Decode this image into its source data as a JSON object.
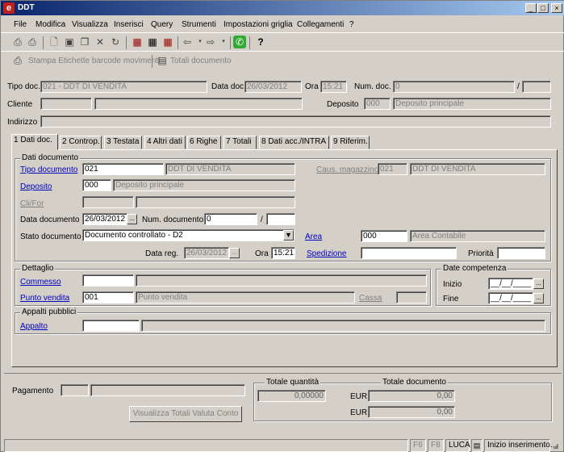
{
  "window": {
    "title": "DDT",
    "icon_letter": "e",
    "min": "_",
    "max": "□",
    "close": "×"
  },
  "menu": [
    "File",
    "Modifica",
    "Visualizza",
    "Inserisci",
    "Query",
    "Strumenti",
    "Impostazioni griglia",
    "Collegamenti",
    "?"
  ],
  "toolbar2": {
    "print_labels": "Stampa Etichette barcode movimenti",
    "totals": "Totali documento"
  },
  "header": {
    "tipo_doc_label": "Tipo doc.",
    "tipo_doc_value": "021 - DDT DI VENDITA",
    "data_doc_label": "Data doc.",
    "data_doc_value": "26/03/2012",
    "ora_label": "Ora",
    "ora_value": "15:21",
    "num_doc_label": "Num. doc.",
    "num_doc_value": "0",
    "slash": "/",
    "cliente_label": "Cliente",
    "deposito_label": "Deposito",
    "deposito_code": "000",
    "deposito_desc": "Deposito principale",
    "indirizzo_label": "Indirizzo"
  },
  "tabs": [
    "1 Dati doc.",
    "2 Controp.",
    "3 Testata",
    "4 Altri dati",
    "6 Righe",
    "7 Totali",
    "8 Dati acc./INTRA",
    "9 Riferim."
  ],
  "dati_documento": {
    "title": "Dati documento",
    "tipo_documento_label": "Tipo documento",
    "tipo_documento_code": "021",
    "tipo_documento_desc": "DDT DI VENDITA",
    "caus_magazzino_label": "Caus. magazzino",
    "caus_magazzino_code": "021",
    "caus_magazzino_desc": "DDT DI VENDITA",
    "deposito_label": "Deposito",
    "deposito_code": "000",
    "deposito_desc": "Deposito principale",
    "clifor_label": "Cli/For",
    "data_documento_label": "Data documento",
    "data_documento_value": "26/03/2012",
    "dots": "...",
    "num_documento_label": "Num. documento",
    "num_documento_value": "0",
    "slash": "/",
    "stato_documento_label": "Stato documento",
    "stato_documento_value": "Documento controllato - D2",
    "area_label": "Area",
    "area_code": "000",
    "area_desc": "Area Contabile",
    "data_reg_label": "Data reg.",
    "data_reg_value": "26/03/2012",
    "ora_label": "Ora",
    "ora_value": "15:21",
    "spedizione_label": "Spedizione",
    "priorita_label": "Priorità"
  },
  "dettaglio": {
    "title": "Dettaglio",
    "commesso_label": "Commesso",
    "punto_vendita_label": "Punto vendita",
    "punto_vendita_code": "001",
    "punto_vendita_desc": "Punto vendita",
    "cassa_label": "Cassa"
  },
  "date_competenza": {
    "title": "Date competenza",
    "inizio_label": "Inizio",
    "inizio_value": "__/__/____",
    "fine_label": "Fine",
    "fine_value": "__/__/____"
  },
  "appalti": {
    "title": "Appalti pubblici",
    "appalto_label": "Appalto"
  },
  "footer": {
    "pagamento_label": "Pagamento",
    "btn_visualizza": "Visualizza Totali  Valuta Conto",
    "totale_quantita_label": "Totale quantità",
    "totale_quantita_value": "0,00000",
    "totale_documento_label": "Totale documento",
    "eur1_label": "EUR",
    "eur1_value": "0,00",
    "eur2_label": "EUR",
    "eur2_value": "0,00"
  },
  "statusbar": {
    "f6": "F6",
    "f8": "F8",
    "user": "LUCA",
    "mode": "Inizio inserimento..."
  }
}
